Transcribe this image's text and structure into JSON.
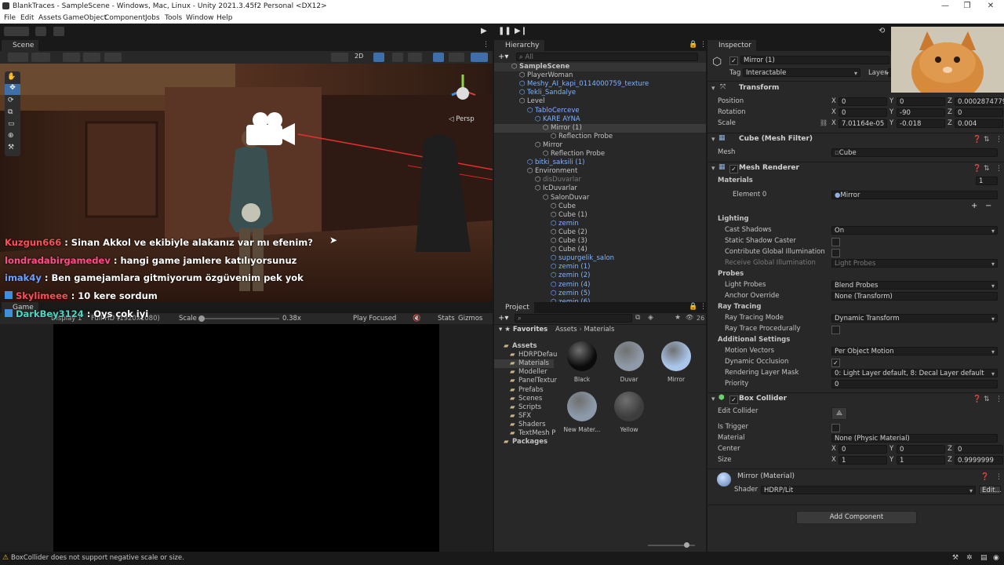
{
  "window": {
    "title": "BlankTraces - SampleScene - Windows, Mac, Linux - Unity 2021.3.45f2 Personal <DX12>"
  },
  "menu": [
    "File",
    "Edit",
    "Assets",
    "GameObject",
    "Component",
    "Jobs",
    "Tools",
    "Window",
    "Help"
  ],
  "scene": {
    "tab": "Scene",
    "view_2d": "2D",
    "persp": "◁ Persp"
  },
  "chat": [
    {
      "user": "Kuzgun666",
      "color": "#ff4d5a",
      "msg": " : Sinan Akkol ve ekibiyle alakanız var mı efenim?"
    },
    {
      "user": "londradabirgamedev",
      "color": "#ff4d8a",
      "msg": " : hangi game jamlere katılıyorsunuz"
    },
    {
      "user": "imak4y",
      "color": "#6fa0ff",
      "msg": " : Ben gamejamlara gitmiyorum özgüvenim pek yok"
    },
    {
      "user": "Skylimeee",
      "color": "#ff4d5a",
      "msg": " : 10 kere sordum"
    },
    {
      "user": "DarkBey3124",
      "color": "#4dd6c1",
      "msg": " : Oys çok iyi"
    }
  ],
  "game": {
    "tab": "Game",
    "display": "Display 1",
    "resolution": "Full HD (1920x1080)",
    "scale_label": "Scale",
    "scale_value": "0.38x",
    "play_mode": "Play Focused",
    "stats": "Stats",
    "gizmos": "Gizmos"
  },
  "hierarchy": {
    "tab": "Hierarchy",
    "search_placeholder": "All",
    "rows": [
      {
        "text": "SampleScene",
        "indent": 0,
        "style": "bold"
      },
      {
        "text": "PlayerWoman",
        "indent": 1,
        "style": "normal"
      },
      {
        "text": "Meshy_AI_kapi_0114000759_texture",
        "indent": 1,
        "style": "blue"
      },
      {
        "text": "Tekli_Sandalye",
        "indent": 1,
        "style": "blue"
      },
      {
        "text": "Level",
        "indent": 1,
        "style": "normal"
      },
      {
        "text": "TabloCerceve",
        "indent": 2,
        "style": "blue"
      },
      {
        "text": "KARE AYNA",
        "indent": 3,
        "style": "blue"
      },
      {
        "text": "Mirror (1)",
        "indent": 4,
        "style": "selected"
      },
      {
        "text": "Reflection Probe",
        "indent": 5,
        "style": "normal"
      },
      {
        "text": "Mirror",
        "indent": 3,
        "style": "normal"
      },
      {
        "text": "Reflection Probe",
        "indent": 4,
        "style": "normal"
      },
      {
        "text": "bitki_saksili (1)",
        "indent": 2,
        "style": "blue"
      },
      {
        "text": "Environment",
        "indent": 2,
        "style": "normal"
      },
      {
        "text": "disDuvarlar",
        "indent": 3,
        "style": "dim"
      },
      {
        "text": "IcDuvarlar",
        "indent": 3,
        "style": "normal"
      },
      {
        "text": "SalonDuvar",
        "indent": 4,
        "style": "normal"
      },
      {
        "text": "Cube",
        "indent": 5,
        "style": "normal"
      },
      {
        "text": "Cube (1)",
        "indent": 5,
        "style": "normal"
      },
      {
        "text": "zemin",
        "indent": 5,
        "style": "blue"
      },
      {
        "text": "Cube (2)",
        "indent": 5,
        "style": "normal"
      },
      {
        "text": "Cube (3)",
        "indent": 5,
        "style": "normal"
      },
      {
        "text": "Cube (4)",
        "indent": 5,
        "style": "normal"
      },
      {
        "text": "supurgelik_salon",
        "indent": 5,
        "style": "blue"
      },
      {
        "text": "zemin (1)",
        "indent": 5,
        "style": "blue"
      },
      {
        "text": "zemin (2)",
        "indent": 5,
        "style": "blue"
      },
      {
        "text": "zemin (4)",
        "indent": 5,
        "style": "blue"
      },
      {
        "text": "zemin (5)",
        "indent": 5,
        "style": "blue"
      },
      {
        "text": "zemin (6)",
        "indent": 5,
        "style": "blue"
      }
    ]
  },
  "project": {
    "tab": "Project",
    "count": "26",
    "favorites": "Favorites",
    "breadcrumb_root": "Assets",
    "breadcrumb_sep": "›",
    "breadcrumb_leaf": "Materials",
    "tree": [
      {
        "text": "Assets",
        "indent": 0,
        "bold": true
      },
      {
        "text": "HDRPDefau",
        "indent": 1,
        "bold": false
      },
      {
        "text": "Materials",
        "indent": 1,
        "bold": false,
        "selected": true
      },
      {
        "text": "Modeller",
        "indent": 1,
        "bold": false
      },
      {
        "text": "PanelTextur",
        "indent": 1,
        "bold": false
      },
      {
        "text": "Prefabs",
        "indent": 1,
        "bold": false
      },
      {
        "text": "Scenes",
        "indent": 1,
        "bold": false
      },
      {
        "text": "Scripts",
        "indent": 1,
        "bold": false
      },
      {
        "text": "SFX",
        "indent": 1,
        "bold": false
      },
      {
        "text": "Shaders",
        "indent": 1,
        "bold": false
      },
      {
        "text": "TextMesh P",
        "indent": 1,
        "bold": false
      },
      {
        "text": "Packages",
        "indent": 0,
        "bold": true
      }
    ],
    "assets": [
      {
        "name": "Black",
        "color": "#0b0b0b"
      },
      {
        "name": "Duvar",
        "color": "#8f9aa8"
      },
      {
        "name": "Mirror",
        "color": "#a9c6ea"
      },
      {
        "name": "New Mater...",
        "color": "#8d9aab"
      },
      {
        "name": "Yellow",
        "color": "#3d3d3d"
      }
    ]
  },
  "inspector": {
    "tab": "Inspector",
    "object_name": "Mirror (1)",
    "tag_label": "Tag",
    "tag_value": "Interactable",
    "layer_label": "Layer",
    "transform": {
      "title": "Transform",
      "position_label": "Position",
      "pos": [
        "0",
        "0",
        "0.0002874779"
      ],
      "rotation_label": "Rotation",
      "rot": [
        "0",
        "-90",
        "0"
      ],
      "scale_label": "Scale",
      "scl": [
        "7.01164e-05",
        "-0.018",
        "0.004"
      ]
    },
    "mesh_filter": {
      "title": "Cube (Mesh Filter)",
      "mesh_label": "Mesh",
      "mesh_value": "Cube"
    },
    "mesh_renderer": {
      "title": "Mesh Renderer",
      "materials_label": "Materials",
      "materials_count": "1",
      "element0_label": "Element 0",
      "element0_value": "Mirror",
      "lighting": "Lighting",
      "cast_shadows_label": "Cast Shadows",
      "cast_shadows_value": "On",
      "static_shadow_label": "Static Shadow Caster",
      "contrib_gi_label": "Contribute Global Illumination",
      "receive_gi_label": "Receive Global Illumination",
      "receive_gi_value": "Light Probes",
      "probes": "Probes",
      "light_probes_label": "Light Probes",
      "light_probes_value": "Blend Probes",
      "anchor_label": "Anchor Override",
      "anchor_value": "None (Transform)",
      "ray_tracing": "Ray Tracing",
      "rt_mode_label": "Ray Tracing Mode",
      "rt_mode_value": "Dynamic Transform",
      "rt_proc_label": "Ray Trace Procedurally",
      "additional": "Additional Settings",
      "motion_label": "Motion Vectors",
      "motion_value": "Per Object Motion",
      "dyn_occ_label": "Dynamic Occlusion",
      "rlm_label": "Rendering Layer Mask",
      "rlm_value": "0: Light Layer default, 8: Decal Layer default",
      "priority_label": "Priority",
      "priority_value": "0"
    },
    "box_collider": {
      "title": "Box Collider",
      "edit_label": "Edit Collider",
      "trigger_label": "Is Trigger",
      "material_label": "Material",
      "material_value": "None (Physic Material)",
      "center_label": "Center",
      "center": [
        "0",
        "0",
        "0"
      ],
      "size_label": "Size",
      "size": [
        "1",
        "1",
        "0.9999999"
      ]
    },
    "material": {
      "title": "Mirror (Material)",
      "shader_label": "Shader",
      "shader_value": "HDRP/Lit",
      "edit": "Edit..."
    },
    "add_component": "Add Component",
    "axis_x": "X",
    "axis_y": "Y",
    "axis_z": "Z"
  },
  "status": {
    "message": "BoxCollider does not support negative scale or size."
  }
}
